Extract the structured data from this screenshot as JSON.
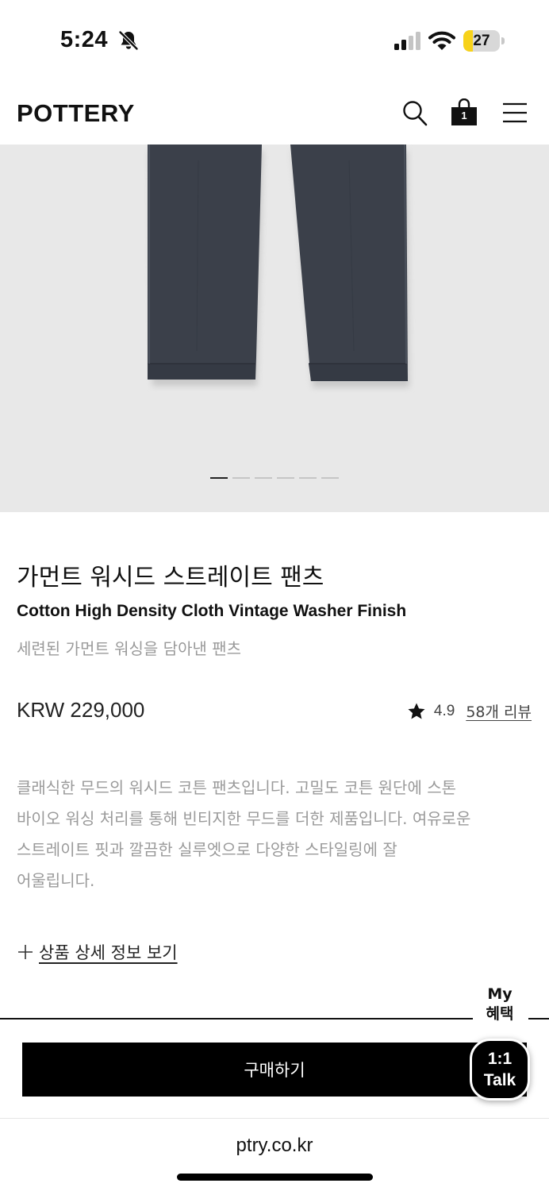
{
  "status_bar": {
    "time": "5:24",
    "battery": "27",
    "battery_level": 0.27,
    "icons": [
      "bell-slash-icon",
      "cellular-signal-icon",
      "wifi-icon",
      "battery-icon"
    ]
  },
  "header": {
    "logo": "POTTERY",
    "cart_count": "1",
    "icons": [
      "search-icon",
      "shopping-bag-icon",
      "hamburger-menu-icon"
    ]
  },
  "carousel": {
    "total_slides": 6,
    "active_index": 0
  },
  "product": {
    "name_ko": "가먼트 워시드 스트레이트 팬츠",
    "name_en": "Cotton High Density Cloth Vintage Washer Finish",
    "tagline": "세련된 가먼트 워싱을 담아낸 팬츠",
    "price": "KRW 229,000",
    "rating": "4.9",
    "reviews": "58개 리뷰",
    "description_lines": [
      "클래식한 무드의 워시드 코튼 팬츠입니다. 고밀도 코튼 원단에 스톤",
      "바이오 워싱 처리를 통해 빈티지한 무드를 더한 제품입니다. 여유로운",
      "스트레이트 핏과 깔끔한 실루엣으로 다양한 스타일링에 잘",
      "어울립니다."
    ],
    "detail_toggle": "상품 상세 정보 보기"
  },
  "bottom": {
    "my_benefit_line1": "My",
    "my_benefit_line2": "혜택",
    "buy_label": "구매하기",
    "talk_line1": "1:1",
    "talk_line2": "Talk"
  },
  "browser": {
    "url": "ptry.co.kr"
  },
  "colors": {
    "primary": "#000000",
    "muted_text": "#9a9a9a",
    "image_bg": "#e8e8e8",
    "pants": "#3b404a",
    "battery_fill": "#f7d21a"
  }
}
